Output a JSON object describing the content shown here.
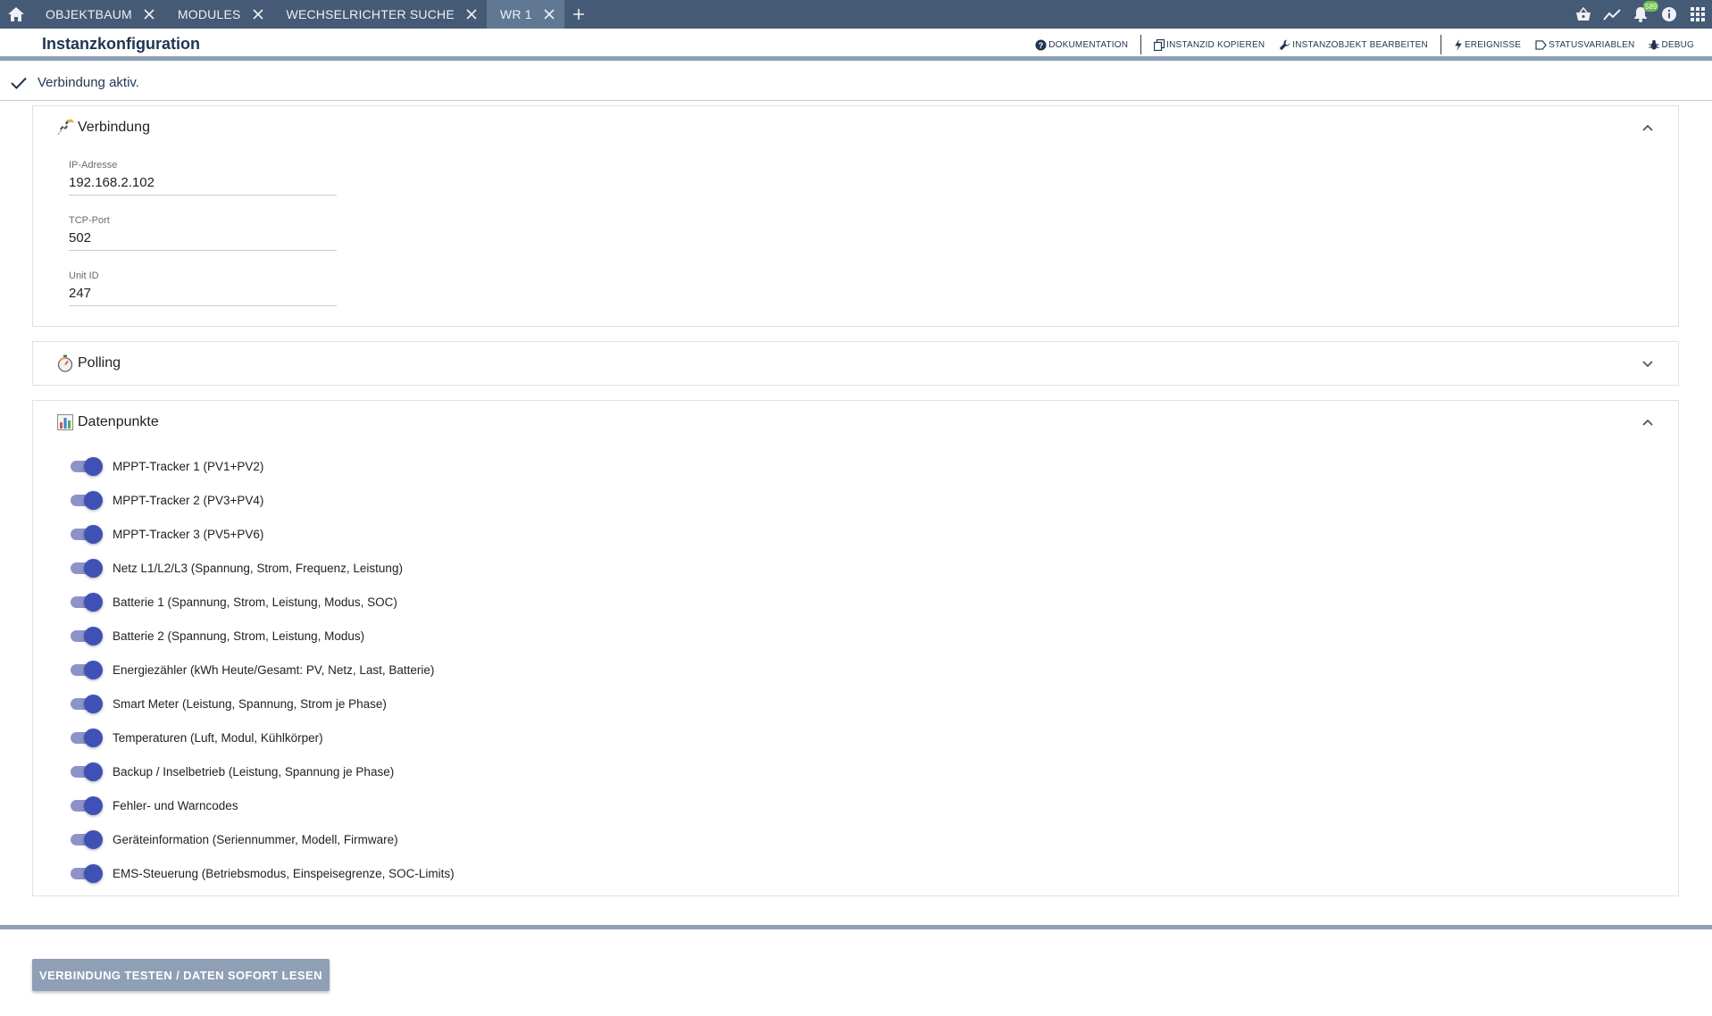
{
  "tabs": [
    {
      "label": "OBJEKTBAUM"
    },
    {
      "label": "MODULES"
    },
    {
      "label": "WECHSELRICHTER SUCHE"
    },
    {
      "label": "WR 1",
      "active": true
    }
  ],
  "top_icons": [
    "basket-icon",
    "trend-icon",
    "bell-icon",
    "info-icon",
    "apps-grid-icon"
  ],
  "notifications": {
    "count": "589"
  },
  "header": {
    "title": "Instanzkonfiguration",
    "actions": {
      "documentation": "DOKUMENTATION",
      "copy_id": "INSTANZID KOPIEREN",
      "edit_object": "INSTANZOBJEKT BEARBEITEN",
      "events": "EREIGNISSE",
      "status_vars": "STATUSVARIABLEN",
      "debug": "DEBUG"
    }
  },
  "status": {
    "text": "Verbindung aktiv."
  },
  "sections": {
    "connection": {
      "title": "Verbindung",
      "expanded": true,
      "fields": [
        {
          "label": "IP-Adresse",
          "value": "192.168.2.102"
        },
        {
          "label": "TCP-Port",
          "value": "502"
        },
        {
          "label": "Unit ID",
          "value": "247"
        }
      ]
    },
    "polling": {
      "title": "Polling",
      "expanded": false
    },
    "datapoints": {
      "title": "Datenpunkte",
      "expanded": true,
      "items": [
        {
          "label": "MPPT-Tracker 1 (PV1+PV2)",
          "enabled": true
        },
        {
          "label": "MPPT-Tracker 2 (PV3+PV4)",
          "enabled": true
        },
        {
          "label": "MPPT-Tracker 3 (PV5+PV6)",
          "enabled": true
        },
        {
          "label": "Netz L1/L2/L3 (Spannung, Strom, Frequenz, Leistung)",
          "enabled": true
        },
        {
          "label": "Batterie 1 (Spannung, Strom, Leistung, Modus, SOC)",
          "enabled": true
        },
        {
          "label": "Batterie 2 (Spannung, Strom, Leistung, Modus)",
          "enabled": true
        },
        {
          "label": "Energiezähler (kWh Heute/Gesamt: PV, Netz, Last, Batterie)",
          "enabled": true
        },
        {
          "label": "Smart Meter (Leistung, Spannung, Strom je Phase)",
          "enabled": true
        },
        {
          "label": "Temperaturen (Luft, Modul, Kühlkörper)",
          "enabled": true
        },
        {
          "label": "Backup / Inselbetrieb (Leistung, Spannung je Phase)",
          "enabled": true
        },
        {
          "label": "Fehler- und Warncodes",
          "enabled": true
        },
        {
          "label": "Geräteinformation (Seriennummer, Modell, Firmware)",
          "enabled": true
        },
        {
          "label": "EMS-Steuerung (Betriebsmodus, Einspeisegrenze, SOC-Limits)",
          "enabled": true
        }
      ]
    }
  },
  "footer": {
    "test_button": "VERBINDUNG TESTEN / DATEN SOFORT LESEN"
  },
  "colors": {
    "tabbar": "#455a75",
    "tab_active": "#617894",
    "accent": "#3f51b5",
    "button": "#8f9fb5"
  }
}
